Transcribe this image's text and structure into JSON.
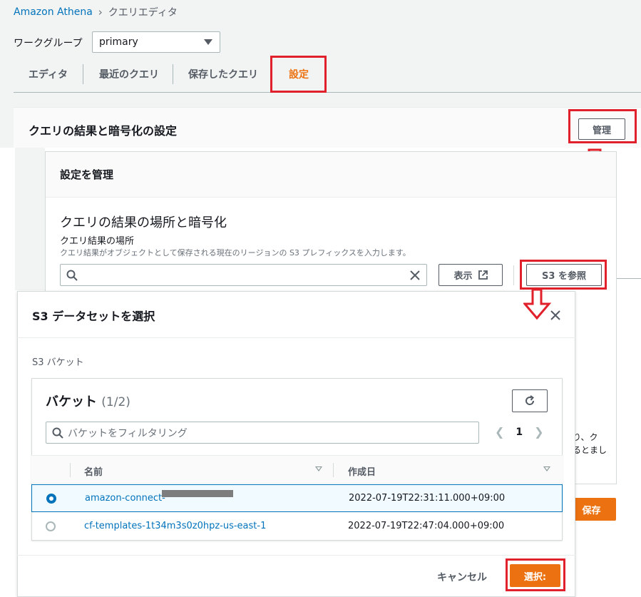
{
  "breadcrumb": {
    "root": "Amazon Athena",
    "current": "クエリエディタ"
  },
  "workgroup": {
    "label": "ワークグループ",
    "value": "primary"
  },
  "tabs": [
    {
      "label": "エディタ"
    },
    {
      "label": "最近のクエリ"
    },
    {
      "label": "保存したクエリ"
    },
    {
      "label": "設定",
      "active": true
    }
  ],
  "settings_panel": {
    "title": "クエリの結果と暗号化の設定",
    "manage_button": "管理"
  },
  "manage_panel": {
    "title": "設定を管理",
    "section_title": "クエリの結果の場所と暗号化",
    "field_label": "クエリ結果の場所",
    "field_description": "クエリ結果がオブジェクトとして保存される現在のリージョンの S3 プレフィックスを入力します。",
    "search_value": "",
    "view_button": "表示",
    "browse_button": "S3 を参照",
    "partial_text_line1": "り、ク",
    "partial_text_line2": "るとまし",
    "save_button": "保存"
  },
  "modal": {
    "title": "S3 データセットを選択",
    "bucket_section_label": "S3 バケット",
    "buckets_title": "バケット",
    "buckets_count": "(1/2)",
    "filter_placeholder": "バケットをフィルタリング",
    "page_number": "1",
    "columns": {
      "name": "名前",
      "created": "作成日"
    },
    "rows": [
      {
        "name": "amazon-connect-",
        "created": "2022-07-19T22:31:11.000+09:00",
        "selected": true
      },
      {
        "name": "cf-templates-1t34m3s0z0hpz-us-east-1",
        "created": "2022-07-19T22:47:04.000+09:00",
        "selected": false
      }
    ],
    "cancel": "キャンセル",
    "select": "選択:"
  },
  "colors": {
    "accent": "#ec7211",
    "link": "#0073bb",
    "annotation": "#e0202a"
  },
  "icons": [
    "search-icon",
    "clear-icon",
    "external-link-icon",
    "close-icon",
    "refresh-icon",
    "chevron-left-icon",
    "chevron-right-icon",
    "sort-icon",
    "down-arrow-annotation-icon",
    "dropdown-caret-icon"
  ]
}
